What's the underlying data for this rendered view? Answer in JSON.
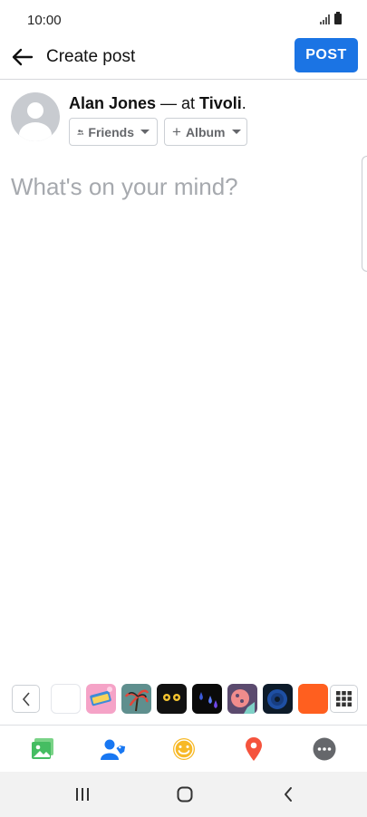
{
  "status_bar": {
    "time": "10:00"
  },
  "header": {
    "title": "Create post",
    "post_label": "POST"
  },
  "composer": {
    "author_name": "Alan Jones",
    "at_text": " — at ",
    "place": "Tivoli",
    "end_punct": ".",
    "audience_label": "Friends",
    "album_label": "Album",
    "placeholder": "What's on your mind?"
  },
  "backgrounds": {
    "colors": [
      "#ffffff",
      "#f5a3c7",
      "#5f8f8e",
      "#111111",
      "#0a0a0a",
      "#5b4a6e",
      "#0d1b2a",
      "#ff5f1f"
    ]
  },
  "actions": [
    "photo-icon",
    "tag-people-icon",
    "feeling-icon",
    "check-in-icon",
    "more-icon"
  ],
  "colors": {
    "brand": "#1b74e4",
    "photo": "#45bd62",
    "tag": "#1877f2",
    "feeling": "#f7b928",
    "checkin": "#f5533d",
    "more": "#65676b"
  }
}
